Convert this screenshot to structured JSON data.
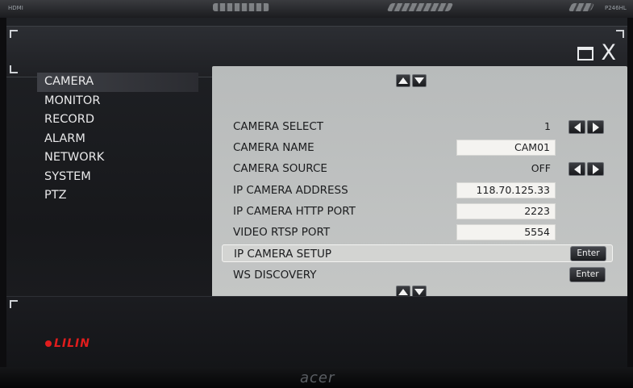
{
  "monitor": {
    "input_label": "HDMI",
    "model_label": "P246HL",
    "brand": "acer"
  },
  "window": {
    "maximize_icon": "maximize-icon",
    "close_label": "X"
  },
  "sidebar": {
    "items": [
      {
        "label": "CAMERA",
        "active": true
      },
      {
        "label": "MONITOR",
        "active": false
      },
      {
        "label": "RECORD",
        "active": false
      },
      {
        "label": "ALARM",
        "active": false
      },
      {
        "label": "NETWORK",
        "active": false
      },
      {
        "label": "SYSTEM",
        "active": false
      },
      {
        "label": "PTZ",
        "active": false
      }
    ]
  },
  "settings": {
    "camera_select": {
      "label": "CAMERA SELECT",
      "value": "1"
    },
    "camera_name": {
      "label": "CAMERA NAME",
      "value": "CAM01"
    },
    "camera_source": {
      "label": "CAMERA SOURCE",
      "value": "OFF"
    },
    "ip_camera_address": {
      "label": "IP CAMERA ADDRESS",
      "value": "118.70.125.33"
    },
    "ip_camera_http_port": {
      "label": "IP CAMERA HTTP PORT",
      "value": "2223"
    },
    "video_rtsp_port": {
      "label": "VIDEO RTSP PORT",
      "value": "5554"
    },
    "ip_camera_setup": {
      "label": "IP CAMERA SETUP",
      "button": "Enter"
    },
    "ws_discovery": {
      "label": "WS DISCOVERY",
      "button": "Enter"
    }
  },
  "brand_logo": "LILIN"
}
